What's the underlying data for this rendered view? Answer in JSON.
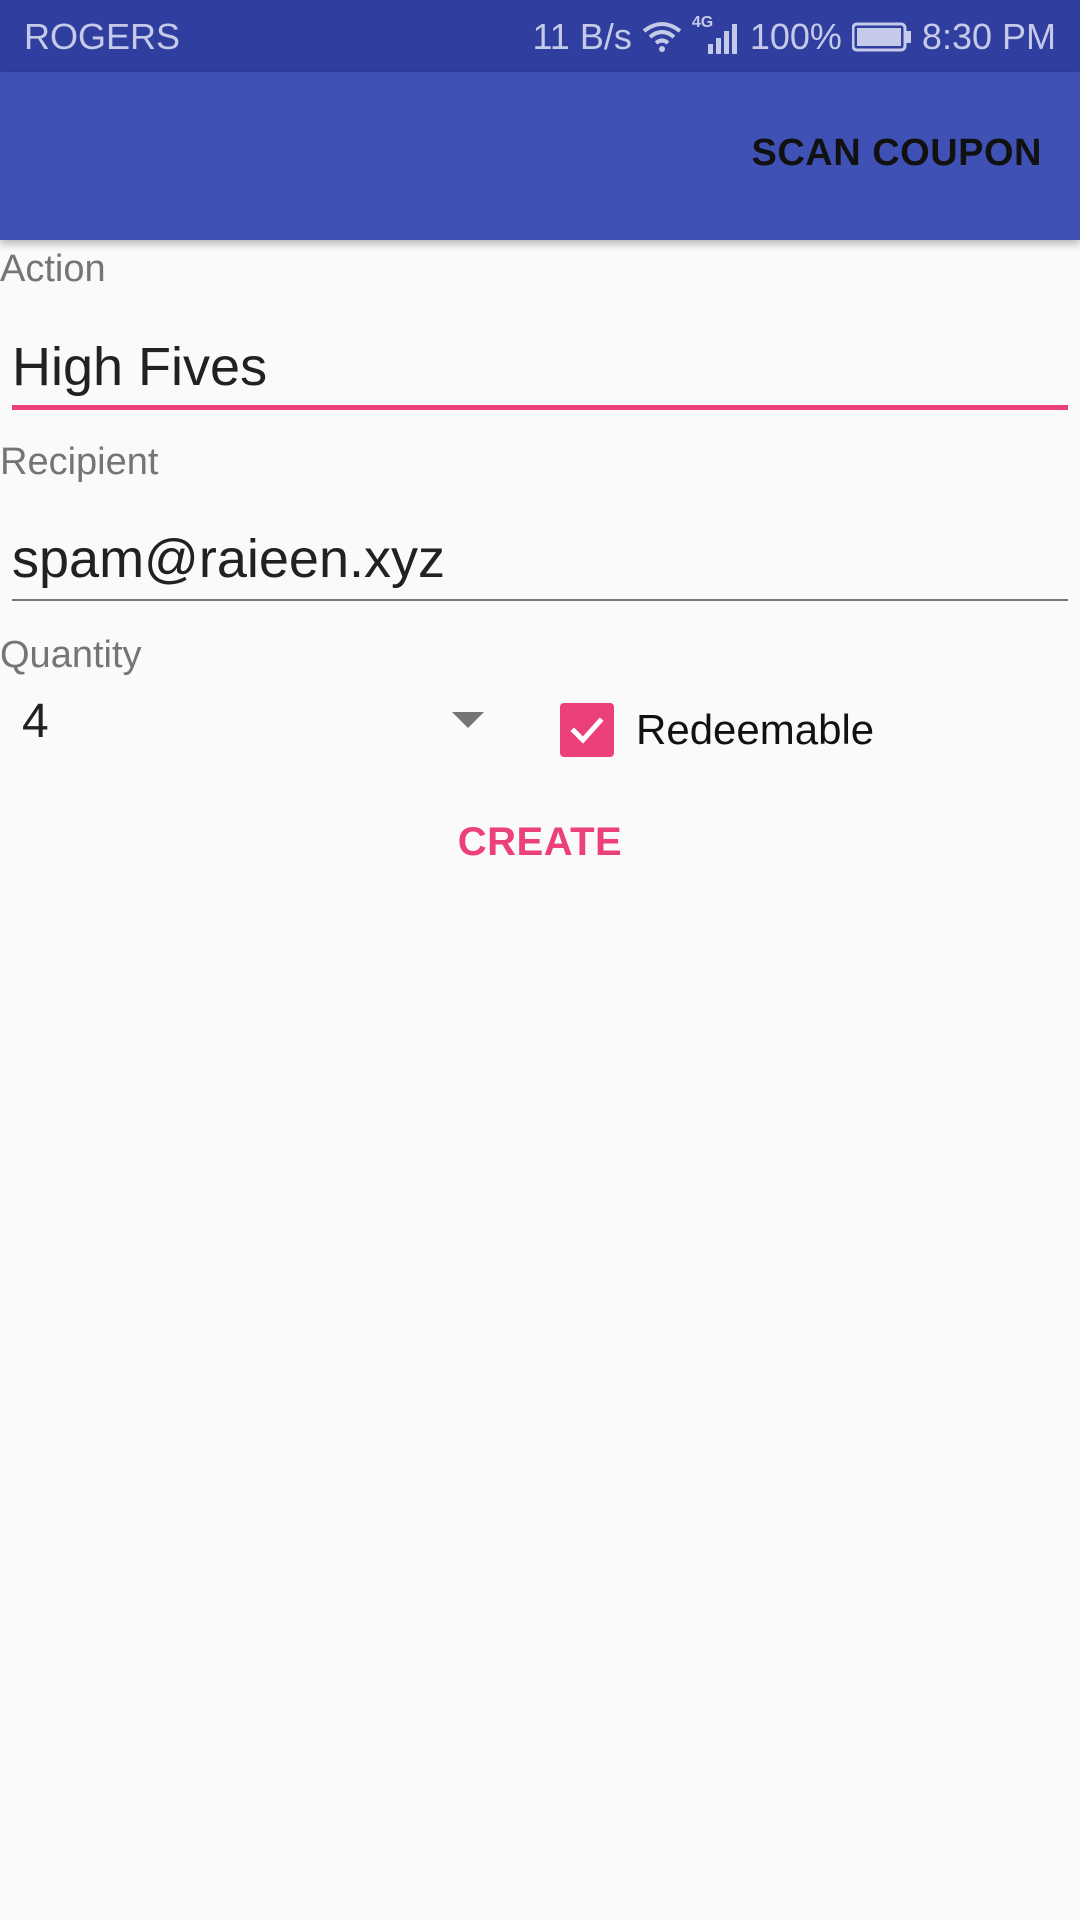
{
  "status_bar": {
    "carrier": "ROGERS",
    "net_speed": "11 B/s",
    "network_type": "4G",
    "battery": "100%",
    "time": "8:30 PM",
    "icons": [
      "wifi-icon",
      "signal-icon",
      "battery-icon"
    ]
  },
  "app_bar": {
    "action_label": "SCAN COUPON"
  },
  "form": {
    "action": {
      "label": "Action",
      "value": "High Fives",
      "focused": true
    },
    "recipient": {
      "label": "Recipient",
      "value": "spam@raieen.xyz"
    },
    "quantity": {
      "label": "Quantity",
      "selected": "4"
    },
    "redeemable": {
      "label": "Redeemable",
      "checked": true
    },
    "create_label": "CREATE"
  },
  "colors": {
    "status_bar": "#303f9f",
    "app_bar": "#3f51b5",
    "accent": "#ec407a",
    "background": "#fafafa"
  }
}
